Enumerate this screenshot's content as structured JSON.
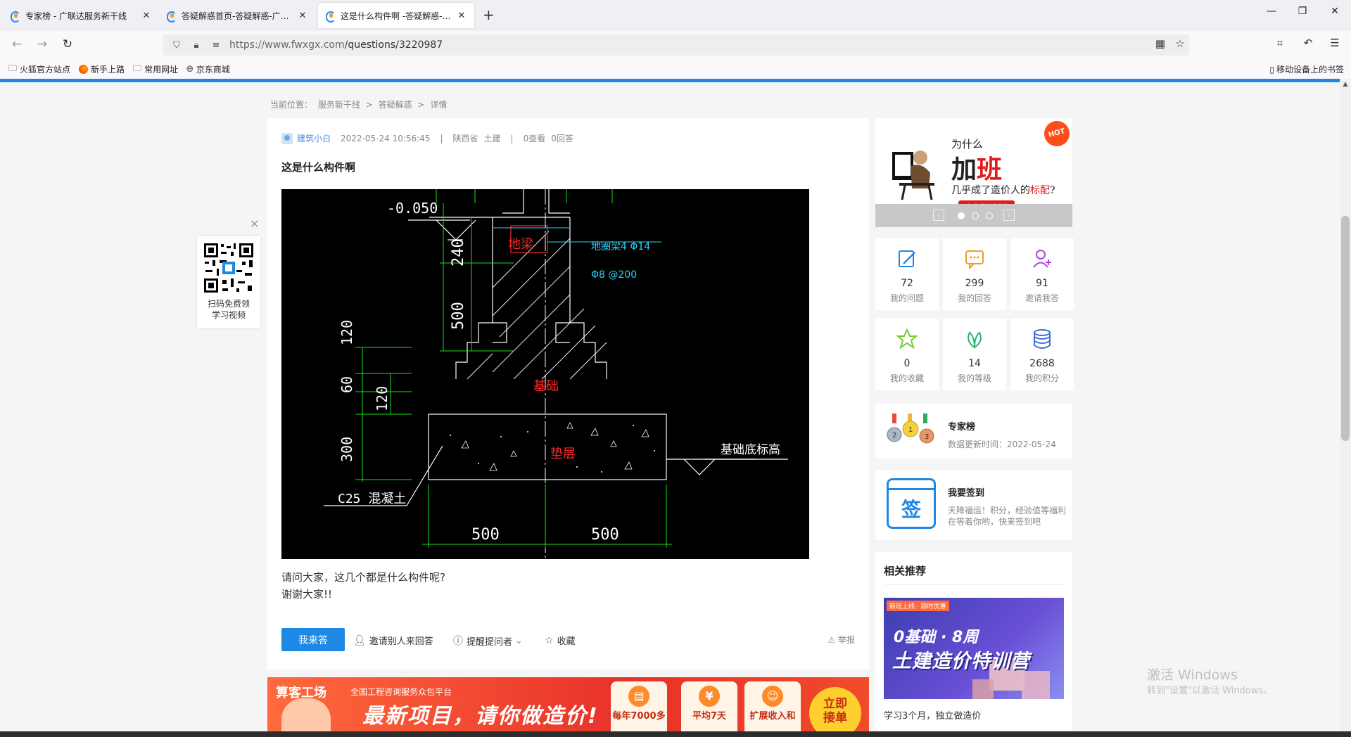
{
  "tabs": [
    {
      "title": "专家榜 - 广联达服务新干线",
      "close": "✕"
    },
    {
      "title": "答疑解惑首页-答疑解惑-广联达",
      "close": "✕"
    },
    {
      "title": "这是什么构件啊 -答疑解惑-广联",
      "close": "✕"
    }
  ],
  "browser": {
    "new_tab": "+",
    "url_host": "https://www.fwxgx.com",
    "url_path": "/questions/3220987",
    "minimize": "—",
    "restore": "❐",
    "close": "✕",
    "back": "←",
    "forward": "→",
    "reload": "↻"
  },
  "bookmarks": [
    "火狐官方站点",
    "新手上路",
    "常用网址",
    "京东商城"
  ],
  "bookmarks_right": "移动设备上的书签",
  "breadcrumb": {
    "prefix": "当前位置：",
    "items": [
      "服务新干线",
      "答疑解惑",
      "详情"
    ],
    "sep": ">"
  },
  "question": {
    "author": "建筑小白",
    "time": "2022-05-24 10:56:45",
    "sep": "|",
    "province": "陕西省",
    "category": "土建",
    "views": "0查看",
    "answers": "0回答",
    "title": "这是什么构件啊",
    "body_line1": "请问大家，这几个都是什么构件呢?",
    "body_line2": "谢谢大家!!"
  },
  "drawing": {
    "elev_top": "-0.050",
    "dims_v": [
      "240",
      "500",
      "120",
      "60",
      "120",
      "300"
    ],
    "dims_h": [
      "500",
      "500"
    ],
    "label_beam": "地梁",
    "label_base": "基础",
    "label_pad": "垫层",
    "rebar1": "地圈梁4 Φ14",
    "rebar2": "Φ8 @200",
    "label_concrete": "C25 混凝土",
    "label_bottom": "基础底标高"
  },
  "actions": {
    "answer": "我来答",
    "invite": "邀请别人来回答",
    "remind": "提醒提问者",
    "collect": "收藏",
    "report": "举报"
  },
  "qr": {
    "text1": "扫码免费领",
    "text2": "学习视频",
    "close": "✕"
  },
  "ad_hot": {
    "line1": "为什么",
    "line2_a": "加",
    "line2_b": "班",
    "line3_a": "几乎成了造价人的",
    "line3_b": "标配",
    "line3_c": "?",
    "cta": "点击参与讨论",
    "badge": "HOT"
  },
  "stats": [
    {
      "num": "72",
      "label": "我的问题",
      "icon": "edit-icon"
    },
    {
      "num": "299",
      "label": "我的回答",
      "icon": "chat-icon"
    },
    {
      "num": "91",
      "label": "邀请我答",
      "icon": "add-user-icon"
    },
    {
      "num": "0",
      "label": "我的收藏",
      "icon": "star-icon"
    },
    {
      "num": "14",
      "label": "我的等级",
      "icon": "leaf-icon"
    },
    {
      "num": "2688",
      "label": "我的积分",
      "icon": "coins-icon"
    }
  ],
  "expert": {
    "title": "专家榜",
    "sub": "数据更新时间：2022-05-24"
  },
  "signin": {
    "title": "我要签到",
    "sub": "天降福运！积分，经验值等福利在等着你哟，快来签到吧",
    "icon_text": "签"
  },
  "reco": {
    "title": "相关推荐",
    "tag": "新班上线 · 限时优惠",
    "img_l1": "0基础 · 8周",
    "img_l2": "土建造价特训营",
    "caption": "学习3个月，独立做造价"
  },
  "banner": {
    "brand": "算客工场",
    "sub": "全国工程咨询服务众包平台",
    "headline": "最新项目，请你做造价!",
    "cards": [
      "每年7000多",
      "平均7天",
      "扩展收入和"
    ],
    "cta_l1": "立即",
    "cta_l2": "接单"
  },
  "watermark": {
    "line1": "激活 Windows",
    "line2": "转到\"设置\"以激活 Windows。"
  },
  "colors": {
    "accent": "#1e88e5",
    "red": "#e21b1b"
  }
}
